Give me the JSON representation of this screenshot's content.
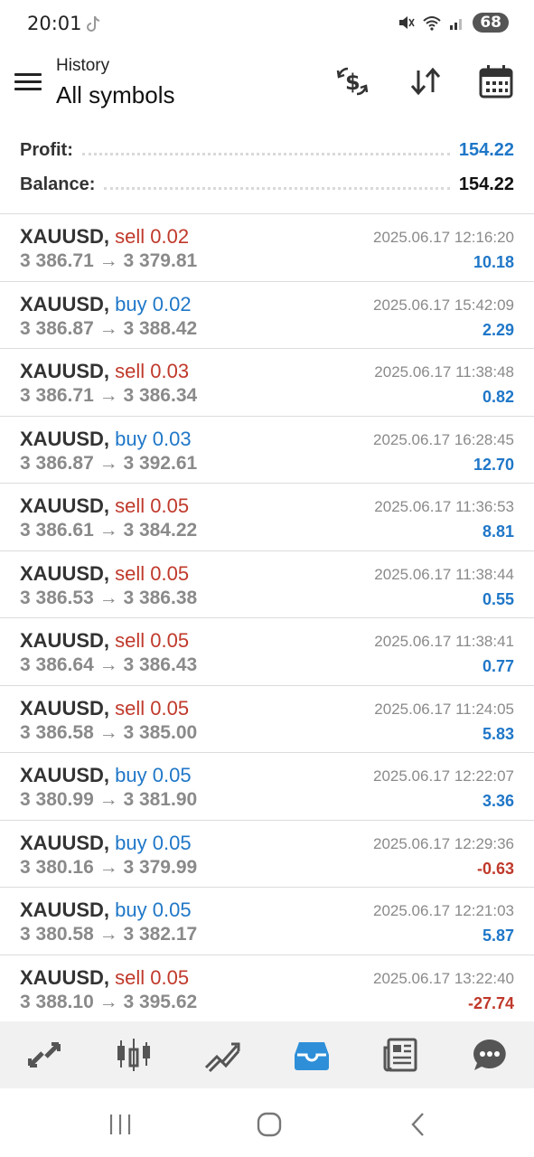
{
  "status_bar": {
    "time": "20:01",
    "battery": "68",
    "icons": [
      "tiktok-icon",
      "mute-icon",
      "wifi-icon",
      "signal-icon"
    ]
  },
  "header": {
    "subtitle": "History",
    "title": "All symbols",
    "icons": [
      "currency-exchange-icon",
      "sort-icon",
      "calendar-icon"
    ]
  },
  "summary": {
    "profit_label": "Profit:",
    "profit_value": "154.22",
    "balance_label": "Balance:",
    "balance_value": "154.22"
  },
  "trades": [
    {
      "symbol": "XAUUSD,",
      "side": "sell",
      "volume": "0.02",
      "open": "3 386.71",
      "close": "3 379.81",
      "time": "2025.06.17 12:16:20",
      "profit": "10.18",
      "positive": true
    },
    {
      "symbol": "XAUUSD,",
      "side": "buy",
      "volume": "0.02",
      "open": "3 386.87",
      "close": "3 388.42",
      "time": "2025.06.17 15:42:09",
      "profit": "2.29",
      "positive": true
    },
    {
      "symbol": "XAUUSD,",
      "side": "sell",
      "volume": "0.03",
      "open": "3 386.71",
      "close": "3 386.34",
      "time": "2025.06.17 11:38:48",
      "profit": "0.82",
      "positive": true
    },
    {
      "symbol": "XAUUSD,",
      "side": "buy",
      "volume": "0.03",
      "open": "3 386.87",
      "close": "3 392.61",
      "time": "2025.06.17 16:28:45",
      "profit": "12.70",
      "positive": true
    },
    {
      "symbol": "XAUUSD,",
      "side": "sell",
      "volume": "0.05",
      "open": "3 386.61",
      "close": "3 384.22",
      "time": "2025.06.17 11:36:53",
      "profit": "8.81",
      "positive": true
    },
    {
      "symbol": "XAUUSD,",
      "side": "sell",
      "volume": "0.05",
      "open": "3 386.53",
      "close": "3 386.38",
      "time": "2025.06.17 11:38:44",
      "profit": "0.55",
      "positive": true
    },
    {
      "symbol": "XAUUSD,",
      "side": "sell",
      "volume": "0.05",
      "open": "3 386.64",
      "close": "3 386.43",
      "time": "2025.06.17 11:38:41",
      "profit": "0.77",
      "positive": true
    },
    {
      "symbol": "XAUUSD,",
      "side": "sell",
      "volume": "0.05",
      "open": "3 386.58",
      "close": "3 385.00",
      "time": "2025.06.17 11:24:05",
      "profit": "5.83",
      "positive": true
    },
    {
      "symbol": "XAUUSD,",
      "side": "buy",
      "volume": "0.05",
      "open": "3 380.99",
      "close": "3 381.90",
      "time": "2025.06.17 12:22:07",
      "profit": "3.36",
      "positive": true
    },
    {
      "symbol": "XAUUSD,",
      "side": "buy",
      "volume": "0.05",
      "open": "3 380.16",
      "close": "3 379.99",
      "time": "2025.06.17 12:29:36",
      "profit": "-0.63",
      "positive": false
    },
    {
      "symbol": "XAUUSD,",
      "side": "buy",
      "volume": "0.05",
      "open": "3 380.58",
      "close": "3 382.17",
      "time": "2025.06.17 12:21:03",
      "profit": "5.87",
      "positive": true
    },
    {
      "symbol": "XAUUSD,",
      "side": "sell",
      "volume": "0.05",
      "open": "3 388.10",
      "close": "3 395.62",
      "time": "2025.06.17 13:22:40",
      "profit": "-27.74",
      "positive": false
    }
  ],
  "arrow": "→",
  "bottom_nav": [
    {
      "icon": "quotes-icon",
      "active": false
    },
    {
      "icon": "chart-icon",
      "active": false
    },
    {
      "icon": "trade-icon",
      "active": false
    },
    {
      "icon": "history-icon",
      "active": true
    },
    {
      "icon": "news-icon",
      "active": false
    },
    {
      "icon": "chat-icon",
      "active": false
    }
  ],
  "colors": {
    "sell": "#c0392b",
    "buy": "#1f77c8",
    "positive": "#1f77c8",
    "negative": "#c0392b",
    "active_nav": "#2e8fd8",
    "inactive_nav": "#555555"
  }
}
